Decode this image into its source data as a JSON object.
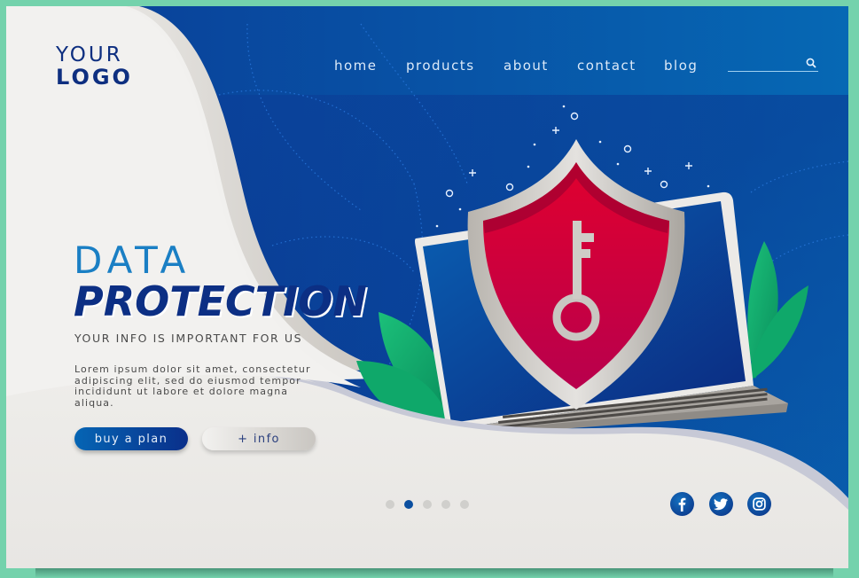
{
  "logo": {
    "line1": "YOUR",
    "line2": "LOGO"
  },
  "nav": {
    "items": [
      {
        "label": "home"
      },
      {
        "label": "products"
      },
      {
        "label": "about"
      },
      {
        "label": "contact"
      },
      {
        "label": "blog"
      }
    ],
    "search": {
      "placeholder": "",
      "value": "",
      "icon": "search-icon"
    }
  },
  "hero": {
    "title_line1": "DATA",
    "title_line2": "PROTECTION",
    "subtitle": "YOUR INFO IS IMPORTANT FOR US",
    "body": "Lorem ipsum dolor sit amet, consectetur adipiscing elit, sed do eiusmod tempor incididunt ut labore et dolore magna aliqua.",
    "buttons": {
      "primary": "buy a plan",
      "secondary": "+ info"
    },
    "illustration": "laptop-with-shield-and-key"
  },
  "carousel": {
    "total": 5,
    "active_index": 2
  },
  "social": [
    {
      "name": "facebook",
      "icon": "facebook-icon"
    },
    {
      "name": "twitter",
      "icon": "twitter-icon"
    },
    {
      "name": "instagram",
      "icon": "instagram-icon"
    }
  ],
  "colors": {
    "frame": "#74d2ac",
    "primary_blue": "#0c2f84",
    "accent_blue": "#1a7fc4",
    "shield_red": "#d4003a",
    "leaf_green": "#14b070",
    "card_bg": "#f3f2f0"
  }
}
